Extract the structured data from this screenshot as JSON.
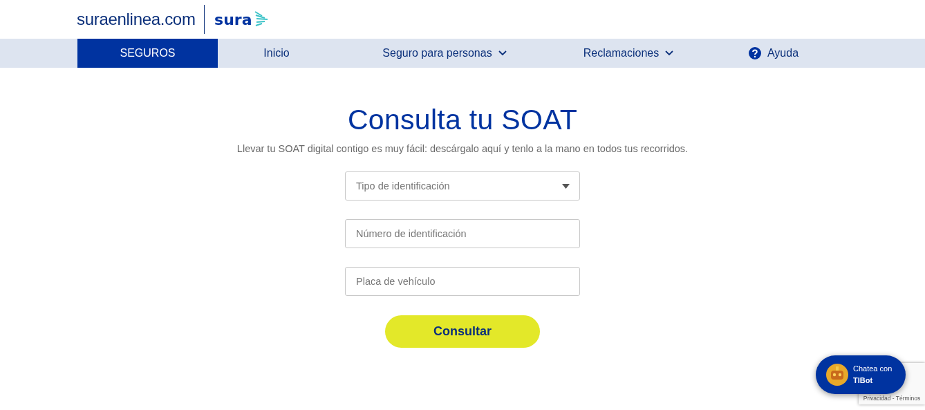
{
  "header": {
    "site_name": "suraenlinea.com",
    "brand": "sura"
  },
  "nav": [
    {
      "label": "SEGUROS",
      "selected": true,
      "kind": "plain"
    },
    {
      "label": "Inicio",
      "selected": false,
      "kind": "plain"
    },
    {
      "label": "Seguro para personas",
      "selected": false,
      "kind": "dropdown"
    },
    {
      "label": "Reclamaciones",
      "selected": false,
      "kind": "dropdown"
    },
    {
      "label": "Ayuda",
      "selected": false,
      "kind": "help"
    }
  ],
  "title": "Consulta tu SOAT",
  "subtitle": "Llevar tu SOAT digital contigo es muy fácil: descárgalo aquí y tenlo a la mano en todos tus recorridos.",
  "fields": [
    {
      "kind": "select",
      "placeholder": "Tipo de identificación"
    },
    {
      "kind": "input",
      "placeholder": "Número de identificación"
    },
    {
      "kind": "input",
      "placeholder": "Placa de vehículo"
    }
  ],
  "submit": "Consultar",
  "chat": {
    "line_1": "Chatea con",
    "line_2": "TIBot"
  },
  "recaptcha": {
    "text": "Privacidad - Términos"
  }
}
